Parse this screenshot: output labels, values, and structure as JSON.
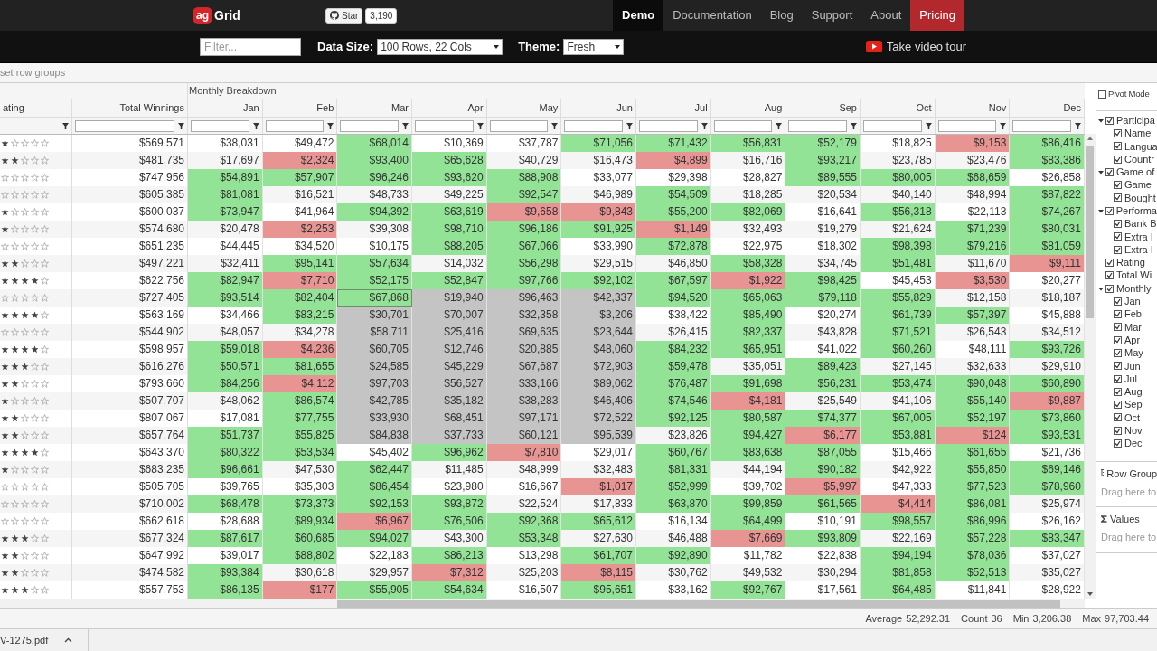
{
  "header": {
    "logo": {
      "mark": "ag",
      "name": "Grid"
    },
    "github": {
      "label": "Star",
      "count": "3,190"
    },
    "nav": [
      {
        "label": "Demo",
        "selected": true,
        "highlighted": false
      },
      {
        "label": "Documentation",
        "selected": false,
        "highlighted": false
      },
      {
        "label": "Blog",
        "selected": false,
        "highlighted": false
      },
      {
        "label": "Support",
        "selected": false,
        "highlighted": false
      },
      {
        "label": "About",
        "selected": false,
        "highlighted": false
      },
      {
        "label": "Pricing",
        "selected": false,
        "highlighted": true
      }
    ]
  },
  "toolbar": {
    "filter": {
      "placeholder": "Filter..."
    },
    "data_size": {
      "label": "Data Size:",
      "value": "100 Rows, 22 Cols"
    },
    "theme": {
      "label": "Theme:",
      "value": "Fresh"
    },
    "video_tour": "Take video tour"
  },
  "row_group_zone": "set row groups",
  "grid": {
    "column_group": "Monthly Breakdown",
    "columns": [
      "ating",
      "Total Winnings",
      "Jan",
      "Feb",
      "Mar",
      "Apr",
      "May",
      "Jun",
      "Jul",
      "Aug",
      "Sep",
      "Oct",
      "Nov",
      "Dec"
    ],
    "rows": [
      {
        "stars": 1,
        "total": "$569,571",
        "months": [
          "$38,031",
          "$49,472",
          "$68,014",
          "$10,369",
          "$37,787",
          "$71,056",
          "$71,432",
          "$56,831",
          "$52,179",
          "$18,825",
          "$9,153",
          "$86,416"
        ],
        "range": [
          false,
          false,
          false,
          false,
          false,
          false,
          false,
          false,
          false,
          false,
          false,
          false
        ],
        "focus": [
          false,
          false,
          false,
          false,
          false,
          false,
          false,
          false,
          false,
          false,
          false,
          false
        ]
      },
      {
        "stars": 2,
        "total": "$481,735",
        "months": [
          "$17,697",
          "$2,324",
          "$93,400",
          "$65,628",
          "$40,729",
          "$16,473",
          "$4,899",
          "$16,716",
          "$93,217",
          "$23,785",
          "$23,476",
          "$83,386"
        ],
        "range": [
          false,
          false,
          false,
          false,
          false,
          false,
          false,
          false,
          false,
          false,
          false,
          false
        ],
        "focus": [
          false,
          false,
          false,
          false,
          false,
          false,
          false,
          false,
          false,
          false,
          false,
          false
        ]
      },
      {
        "stars": 0,
        "total": "$747,956",
        "months": [
          "$54,891",
          "$57,907",
          "$96,246",
          "$93,620",
          "$88,908",
          "$33,077",
          "$29,398",
          "$28,827",
          "$89,555",
          "$80,005",
          "$68,659",
          "$26,858"
        ],
        "range": [
          false,
          false,
          false,
          false,
          false,
          false,
          false,
          false,
          false,
          false,
          false,
          false
        ],
        "focus": [
          false,
          false,
          false,
          false,
          false,
          false,
          false,
          false,
          false,
          false,
          false,
          false
        ]
      },
      {
        "stars": 0,
        "total": "$605,385",
        "months": [
          "$81,081",
          "$16,521",
          "$48,733",
          "$49,225",
          "$92,547",
          "$46,989",
          "$54,509",
          "$18,285",
          "$20,534",
          "$40,140",
          "$48,994",
          "$87,822"
        ],
        "range": [
          false,
          false,
          false,
          false,
          false,
          false,
          false,
          false,
          false,
          false,
          false,
          false
        ],
        "focus": [
          false,
          false,
          false,
          false,
          false,
          false,
          false,
          false,
          false,
          false,
          false,
          false
        ]
      },
      {
        "stars": 1,
        "total": "$600,037",
        "months": [
          "$73,947",
          "$41,964",
          "$94,392",
          "$63,619",
          "$9,658",
          "$9,843",
          "$55,200",
          "$82,069",
          "$16,641",
          "$56,318",
          "$22,113",
          "$74,267"
        ],
        "range": [
          false,
          false,
          false,
          false,
          false,
          false,
          false,
          false,
          false,
          false,
          false,
          false
        ],
        "focus": [
          false,
          false,
          false,
          false,
          false,
          false,
          false,
          false,
          false,
          false,
          false,
          false
        ]
      },
      {
        "stars": 1,
        "total": "$574,680",
        "months": [
          "$20,478",
          "$2,253",
          "$39,308",
          "$98,710",
          "$96,186",
          "$91,925",
          "$1,149",
          "$32,493",
          "$19,279",
          "$21,624",
          "$71,239",
          "$80,031"
        ],
        "range": [
          false,
          false,
          false,
          false,
          false,
          false,
          false,
          false,
          false,
          false,
          false,
          false
        ],
        "focus": [
          false,
          false,
          false,
          false,
          false,
          false,
          false,
          false,
          false,
          false,
          false,
          false
        ]
      },
      {
        "stars": 0,
        "total": "$651,235",
        "months": [
          "$44,445",
          "$34,520",
          "$10,175",
          "$88,205",
          "$67,066",
          "$33,990",
          "$72,878",
          "$22,975",
          "$18,302",
          "$98,398",
          "$79,216",
          "$81,059"
        ],
        "range": [
          false,
          false,
          false,
          false,
          false,
          false,
          false,
          false,
          false,
          false,
          false,
          false
        ],
        "focus": [
          false,
          false,
          false,
          false,
          false,
          false,
          false,
          false,
          false,
          false,
          false,
          false
        ]
      },
      {
        "stars": 2,
        "total": "$497,221",
        "months": [
          "$32,411",
          "$95,141",
          "$57,634",
          "$14,032",
          "$56,298",
          "$29,515",
          "$46,850",
          "$58,328",
          "$34,745",
          "$51,481",
          "$11,670",
          "$9,111"
        ],
        "range": [
          false,
          false,
          false,
          false,
          false,
          false,
          false,
          false,
          false,
          false,
          false,
          false
        ],
        "focus": [
          false,
          false,
          false,
          false,
          false,
          false,
          false,
          false,
          false,
          false,
          false,
          false
        ]
      },
      {
        "stars": 4,
        "total": "$622,756",
        "months": [
          "$82,947",
          "$7,710",
          "$52,175",
          "$52,847",
          "$97,766",
          "$92,102",
          "$67,597",
          "$1,922",
          "$98,425",
          "$45,453",
          "$3,530",
          "$20,277"
        ],
        "range": [
          false,
          false,
          false,
          false,
          false,
          false,
          false,
          false,
          false,
          false,
          false,
          false
        ],
        "focus": [
          false,
          false,
          false,
          false,
          false,
          false,
          false,
          false,
          false,
          false,
          false,
          false
        ]
      },
      {
        "stars": 0,
        "total": "$727,405",
        "months": [
          "$93,514",
          "$82,404",
          "$67,868",
          "$19,940",
          "$96,463",
          "$42,337",
          "$94,520",
          "$65,063",
          "$79,118",
          "$55,829",
          "$12,158",
          "$18,187"
        ],
        "range": [
          false,
          false,
          false,
          true,
          true,
          true,
          false,
          false,
          false,
          false,
          false,
          false
        ],
        "focus": [
          false,
          false,
          true,
          false,
          false,
          false,
          false,
          false,
          false,
          false,
          false,
          false
        ]
      },
      {
        "stars": 4,
        "total": "$563,169",
        "months": [
          "$34,466",
          "$83,215",
          "$30,701",
          "$70,007",
          "$32,358",
          "$3,206",
          "$38,422",
          "$85,490",
          "$20,274",
          "$61,739",
          "$57,397",
          "$45,888"
        ],
        "range": [
          false,
          false,
          true,
          true,
          true,
          true,
          false,
          false,
          false,
          false,
          false,
          false
        ],
        "focus": [
          false,
          false,
          false,
          false,
          false,
          false,
          false,
          false,
          false,
          false,
          false,
          false
        ]
      },
      {
        "stars": 0,
        "total": "$544,902",
        "months": [
          "$48,057",
          "$34,278",
          "$58,711",
          "$25,416",
          "$69,635",
          "$23,644",
          "$26,415",
          "$82,337",
          "$43,828",
          "$71,521",
          "$26,543",
          "$34,512"
        ],
        "range": [
          false,
          false,
          true,
          true,
          true,
          true,
          false,
          false,
          false,
          false,
          false,
          false
        ],
        "focus": [
          false,
          false,
          false,
          false,
          false,
          false,
          false,
          false,
          false,
          false,
          false,
          false
        ]
      },
      {
        "stars": 4,
        "total": "$598,957",
        "months": [
          "$59,018",
          "$4,236",
          "$60,705",
          "$12,746",
          "$20,885",
          "$48,060",
          "$84,232",
          "$65,951",
          "$41,022",
          "$60,260",
          "$48,111",
          "$93,726"
        ],
        "range": [
          false,
          false,
          true,
          true,
          true,
          true,
          false,
          false,
          false,
          false,
          false,
          false
        ],
        "focus": [
          false,
          false,
          false,
          false,
          false,
          false,
          false,
          false,
          false,
          false,
          false,
          false
        ]
      },
      {
        "stars": 3,
        "total": "$616,276",
        "months": [
          "$50,571",
          "$81,655",
          "$24,585",
          "$45,229",
          "$67,687",
          "$72,903",
          "$59,478",
          "$35,051",
          "$89,423",
          "$27,145",
          "$32,633",
          "$29,910"
        ],
        "range": [
          false,
          false,
          true,
          true,
          true,
          true,
          false,
          false,
          false,
          false,
          false,
          false
        ],
        "focus": [
          false,
          false,
          false,
          false,
          false,
          false,
          false,
          false,
          false,
          false,
          false,
          false
        ]
      },
      {
        "stars": 2,
        "total": "$793,660",
        "months": [
          "$84,256",
          "$4,112",
          "$97,703",
          "$56,527",
          "$33,166",
          "$89,062",
          "$76,487",
          "$91,698",
          "$56,231",
          "$53,474",
          "$90,048",
          "$60,890"
        ],
        "range": [
          false,
          false,
          true,
          true,
          true,
          true,
          false,
          false,
          false,
          false,
          false,
          false
        ],
        "focus": [
          false,
          false,
          false,
          false,
          false,
          false,
          false,
          false,
          false,
          false,
          false,
          false
        ]
      },
      {
        "stars": 1,
        "total": "$507,707",
        "months": [
          "$48,062",
          "$86,574",
          "$42,785",
          "$35,182",
          "$38,283",
          "$46,406",
          "$74,546",
          "$4,181",
          "$25,549",
          "$41,106",
          "$55,140",
          "$9,887"
        ],
        "range": [
          false,
          false,
          true,
          true,
          true,
          true,
          false,
          false,
          false,
          false,
          false,
          false
        ],
        "focus": [
          false,
          false,
          false,
          false,
          false,
          false,
          false,
          false,
          false,
          false,
          false,
          false
        ]
      },
      {
        "stars": 2,
        "total": "$807,067",
        "months": [
          "$17,081",
          "$77,755",
          "$33,930",
          "$68,451",
          "$97,171",
          "$72,522",
          "$92,125",
          "$80,587",
          "$74,377",
          "$67,005",
          "$52,197",
          "$73,860"
        ],
        "range": [
          false,
          false,
          true,
          true,
          true,
          true,
          false,
          false,
          false,
          false,
          false,
          false
        ],
        "focus": [
          false,
          false,
          false,
          false,
          false,
          false,
          false,
          false,
          false,
          false,
          false,
          false
        ]
      },
      {
        "stars": 2,
        "total": "$657,764",
        "months": [
          "$51,737",
          "$55,825",
          "$84,838",
          "$37,733",
          "$60,121",
          "$95,539",
          "$23,826",
          "$94,427",
          "$6,177",
          "$53,881",
          "$124",
          "$93,531"
        ],
        "range": [
          false,
          false,
          true,
          true,
          true,
          true,
          false,
          false,
          false,
          false,
          false,
          false
        ],
        "focus": [
          false,
          false,
          false,
          false,
          false,
          false,
          false,
          false,
          false,
          false,
          false,
          false
        ]
      },
      {
        "stars": 4,
        "total": "$643,370",
        "months": [
          "$80,322",
          "$53,534",
          "$45,402",
          "$96,962",
          "$7,810",
          "$29,017",
          "$60,767",
          "$83,638",
          "$87,055",
          "$15,466",
          "$61,655",
          "$21,736"
        ],
        "range": [
          false,
          false,
          false,
          false,
          false,
          false,
          false,
          false,
          false,
          false,
          false,
          false
        ],
        "focus": [
          false,
          false,
          false,
          false,
          false,
          false,
          false,
          false,
          false,
          false,
          false,
          false
        ]
      },
      {
        "stars": 1,
        "total": "$683,235",
        "months": [
          "$96,661",
          "$47,530",
          "$62,447",
          "$11,485",
          "$48,999",
          "$32,483",
          "$81,331",
          "$44,194",
          "$90,182",
          "$42,922",
          "$55,850",
          "$69,146"
        ],
        "range": [
          false,
          false,
          false,
          false,
          false,
          false,
          false,
          false,
          false,
          false,
          false,
          false
        ],
        "focus": [
          false,
          false,
          false,
          false,
          false,
          false,
          false,
          false,
          false,
          false,
          false,
          false
        ]
      },
      {
        "stars": 0,
        "total": "$505,705",
        "months": [
          "$39,765",
          "$35,303",
          "$86,454",
          "$23,980",
          "$16,667",
          "$1,017",
          "$52,999",
          "$39,702",
          "$5,997",
          "$47,333",
          "$77,523",
          "$78,960"
        ],
        "range": [
          false,
          false,
          false,
          false,
          false,
          false,
          false,
          false,
          false,
          false,
          false,
          false
        ],
        "focus": [
          false,
          false,
          false,
          false,
          false,
          false,
          false,
          false,
          false,
          false,
          false,
          false
        ]
      },
      {
        "stars": 0,
        "total": "$710,002",
        "months": [
          "$68,478",
          "$73,373",
          "$92,153",
          "$93,872",
          "$22,524",
          "$17,833",
          "$63,870",
          "$99,859",
          "$61,565",
          "$4,414",
          "$86,081",
          "$25,974"
        ],
        "range": [
          false,
          false,
          false,
          false,
          false,
          false,
          false,
          false,
          false,
          false,
          false,
          false
        ],
        "focus": [
          false,
          false,
          false,
          false,
          false,
          false,
          false,
          false,
          false,
          false,
          false,
          false
        ]
      },
      {
        "stars": 0,
        "total": "$662,618",
        "months": [
          "$28,688",
          "$89,934",
          "$6,967",
          "$76,506",
          "$92,368",
          "$65,612",
          "$16,134",
          "$64,499",
          "$10,191",
          "$98,557",
          "$86,996",
          "$26,162"
        ],
        "range": [
          false,
          false,
          false,
          false,
          false,
          false,
          false,
          false,
          false,
          false,
          false,
          false
        ],
        "focus": [
          false,
          false,
          false,
          false,
          false,
          false,
          false,
          false,
          false,
          false,
          false,
          false
        ]
      },
      {
        "stars": 3,
        "total": "$677,324",
        "months": [
          "$87,617",
          "$60,685",
          "$94,027",
          "$43,300",
          "$53,348",
          "$27,630",
          "$46,488",
          "$7,669",
          "$93,809",
          "$22,169",
          "$57,228",
          "$83,347"
        ],
        "range": [
          false,
          false,
          false,
          false,
          false,
          false,
          false,
          false,
          false,
          false,
          false,
          false
        ],
        "focus": [
          false,
          false,
          false,
          false,
          false,
          false,
          false,
          false,
          false,
          false,
          false,
          false
        ]
      },
      {
        "stars": 2,
        "total": "$647,992",
        "months": [
          "$39,017",
          "$88,802",
          "$22,183",
          "$86,213",
          "$13,298",
          "$61,707",
          "$92,890",
          "$11,782",
          "$22,838",
          "$94,194",
          "$78,036",
          "$37,027"
        ],
        "range": [
          false,
          false,
          false,
          false,
          false,
          false,
          false,
          false,
          false,
          false,
          false,
          false
        ],
        "focus": [
          false,
          false,
          false,
          false,
          false,
          false,
          false,
          false,
          false,
          false,
          false,
          false
        ]
      },
      {
        "stars": 2,
        "total": "$474,582",
        "months": [
          "$93,384",
          "$30,618",
          "$29,957",
          "$7,312",
          "$25,203",
          "$8,115",
          "$30,762",
          "$49,532",
          "$30,294",
          "$81,858",
          "$52,513",
          "$35,027"
        ],
        "range": [
          false,
          false,
          false,
          false,
          false,
          false,
          false,
          false,
          false,
          false,
          false,
          false
        ],
        "focus": [
          false,
          false,
          false,
          false,
          false,
          false,
          false,
          false,
          false,
          false,
          false,
          false
        ]
      },
      {
        "stars": 3,
        "total": "$557,753",
        "months": [
          "$86,135",
          "$177",
          "$55,905",
          "$54,634",
          "$16,507",
          "$95,651",
          "$33,162",
          "$92,767",
          "$17,561",
          "$64,485",
          "$11,841",
          "$28,922"
        ],
        "range": [
          false,
          false,
          false,
          false,
          false,
          false,
          false,
          false,
          false,
          false,
          false,
          false
        ],
        "focus": [
          false,
          false,
          false,
          false,
          false,
          false,
          false,
          false,
          false,
          false,
          false,
          false
        ]
      }
    ]
  },
  "tool_panel": {
    "pivot_mode": {
      "label": "Pivot Mode",
      "checked": false
    },
    "columns": [
      {
        "label": "Participa",
        "checked": true,
        "expanded": true,
        "children": [
          {
            "label": "Name",
            "checked": true
          },
          {
            "label": "Langua",
            "checked": true
          },
          {
            "label": "Countr",
            "checked": true
          }
        ]
      },
      {
        "label": "Game of",
        "checked": true,
        "expanded": true,
        "children": [
          {
            "label": "Game",
            "checked": true
          },
          {
            "label": "Bought",
            "checked": true
          }
        ]
      },
      {
        "label": "Performa",
        "checked": true,
        "expanded": true,
        "children": [
          {
            "label": "Bank B",
            "checked": true
          },
          {
            "label": "Extra I",
            "checked": true
          },
          {
            "label": "Extra I",
            "checked": true
          }
        ]
      },
      {
        "label": "Rating",
        "checked": true
      },
      {
        "label": "Total Wi",
        "checked": true
      },
      {
        "label": "Monthly",
        "checked": true,
        "expanded": true,
        "children": [
          {
            "label": "Jan",
            "checked": true
          },
          {
            "label": "Feb",
            "checked": true
          },
          {
            "label": "Mar",
            "checked": true
          },
          {
            "label": "Apr",
            "checked": true
          },
          {
            "label": "May",
            "checked": true
          },
          {
            "label": "Jun",
            "checked": true
          },
          {
            "label": "Jul",
            "checked": true
          },
          {
            "label": "Aug",
            "checked": true
          },
          {
            "label": "Sep",
            "checked": true
          },
          {
            "label": "Oct",
            "checked": true
          },
          {
            "label": "Nov",
            "checked": true
          },
          {
            "label": "Dec",
            "checked": true
          }
        ]
      }
    ],
    "row_groups": {
      "title": "Row Group",
      "hint": "Drag here to"
    },
    "values": {
      "title": "Values",
      "hint": "Drag here to"
    }
  },
  "status_bar": [
    {
      "label": "Average",
      "value": "52,292.31"
    },
    {
      "label": "Count",
      "value": "36"
    },
    {
      "label": "Min",
      "value": "3,206.38"
    },
    {
      "label": "Max",
      "value": "97,703.44"
    }
  ],
  "downloads": {
    "file": "V-1275.pdf"
  }
}
